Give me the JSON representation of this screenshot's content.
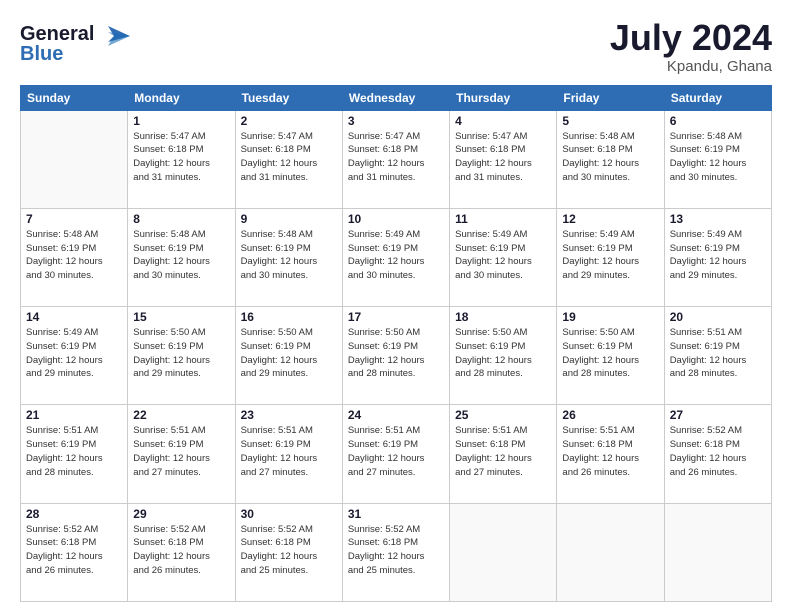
{
  "header": {
    "logo_line1": "General",
    "logo_line2": "Blue",
    "month": "July 2024",
    "location": "Kpandu, Ghana"
  },
  "days_of_week": [
    "Sunday",
    "Monday",
    "Tuesday",
    "Wednesday",
    "Thursday",
    "Friday",
    "Saturday"
  ],
  "weeks": [
    [
      {
        "day": "",
        "info": ""
      },
      {
        "day": "1",
        "info": "Sunrise: 5:47 AM\nSunset: 6:18 PM\nDaylight: 12 hours\nand 31 minutes."
      },
      {
        "day": "2",
        "info": "Sunrise: 5:47 AM\nSunset: 6:18 PM\nDaylight: 12 hours\nand 31 minutes."
      },
      {
        "day": "3",
        "info": "Sunrise: 5:47 AM\nSunset: 6:18 PM\nDaylight: 12 hours\nand 31 minutes."
      },
      {
        "day": "4",
        "info": "Sunrise: 5:47 AM\nSunset: 6:18 PM\nDaylight: 12 hours\nand 31 minutes."
      },
      {
        "day": "5",
        "info": "Sunrise: 5:48 AM\nSunset: 6:18 PM\nDaylight: 12 hours\nand 30 minutes."
      },
      {
        "day": "6",
        "info": "Sunrise: 5:48 AM\nSunset: 6:19 PM\nDaylight: 12 hours\nand 30 minutes."
      }
    ],
    [
      {
        "day": "7",
        "info": ""
      },
      {
        "day": "8",
        "info": "Sunrise: 5:48 AM\nSunset: 6:19 PM\nDaylight: 12 hours\nand 30 minutes."
      },
      {
        "day": "9",
        "info": "Sunrise: 5:48 AM\nSunset: 6:19 PM\nDaylight: 12 hours\nand 30 minutes."
      },
      {
        "day": "10",
        "info": "Sunrise: 5:49 AM\nSunset: 6:19 PM\nDaylight: 12 hours\nand 30 minutes."
      },
      {
        "day": "11",
        "info": "Sunrise: 5:49 AM\nSunset: 6:19 PM\nDaylight: 12 hours\nand 30 minutes."
      },
      {
        "day": "12",
        "info": "Sunrise: 5:49 AM\nSunset: 6:19 PM\nDaylight: 12 hours\nand 29 minutes."
      },
      {
        "day": "13",
        "info": "Sunrise: 5:49 AM\nSunset: 6:19 PM\nDaylight: 12 hours\nand 29 minutes."
      }
    ],
    [
      {
        "day": "14",
        "info": ""
      },
      {
        "day": "15",
        "info": "Sunrise: 5:50 AM\nSunset: 6:19 PM\nDaylight: 12 hours\nand 29 minutes."
      },
      {
        "day": "16",
        "info": "Sunrise: 5:50 AM\nSunset: 6:19 PM\nDaylight: 12 hours\nand 29 minutes."
      },
      {
        "day": "17",
        "info": "Sunrise: 5:50 AM\nSunset: 6:19 PM\nDaylight: 12 hours\nand 28 minutes."
      },
      {
        "day": "18",
        "info": "Sunrise: 5:50 AM\nSunset: 6:19 PM\nDaylight: 12 hours\nand 28 minutes."
      },
      {
        "day": "19",
        "info": "Sunrise: 5:50 AM\nSunset: 6:19 PM\nDaylight: 12 hours\nand 28 minutes."
      },
      {
        "day": "20",
        "info": "Sunrise: 5:51 AM\nSunset: 6:19 PM\nDaylight: 12 hours\nand 28 minutes."
      }
    ],
    [
      {
        "day": "21",
        "info": ""
      },
      {
        "day": "22",
        "info": "Sunrise: 5:51 AM\nSunset: 6:19 PM\nDaylight: 12 hours\nand 27 minutes."
      },
      {
        "day": "23",
        "info": "Sunrise: 5:51 AM\nSunset: 6:19 PM\nDaylight: 12 hours\nand 27 minutes."
      },
      {
        "day": "24",
        "info": "Sunrise: 5:51 AM\nSunset: 6:19 PM\nDaylight: 12 hours\nand 27 minutes."
      },
      {
        "day": "25",
        "info": "Sunrise: 5:51 AM\nSunset: 6:18 PM\nDaylight: 12 hours\nand 27 minutes."
      },
      {
        "day": "26",
        "info": "Sunrise: 5:51 AM\nSunset: 6:18 PM\nDaylight: 12 hours\nand 26 minutes."
      },
      {
        "day": "27",
        "info": "Sunrise: 5:52 AM\nSunset: 6:18 PM\nDaylight: 12 hours\nand 26 minutes."
      }
    ],
    [
      {
        "day": "28",
        "info": "Sunrise: 5:52 AM\nSunset: 6:18 PM\nDaylight: 12 hours\nand 26 minutes."
      },
      {
        "day": "29",
        "info": "Sunrise: 5:52 AM\nSunset: 6:18 PM\nDaylight: 12 hours\nand 26 minutes."
      },
      {
        "day": "30",
        "info": "Sunrise: 5:52 AM\nSunset: 6:18 PM\nDaylight: 12 hours\nand 25 minutes."
      },
      {
        "day": "31",
        "info": "Sunrise: 5:52 AM\nSunset: 6:18 PM\nDaylight: 12 hours\nand 25 minutes."
      },
      {
        "day": "",
        "info": ""
      },
      {
        "day": "",
        "info": ""
      },
      {
        "day": "",
        "info": ""
      }
    ]
  ]
}
